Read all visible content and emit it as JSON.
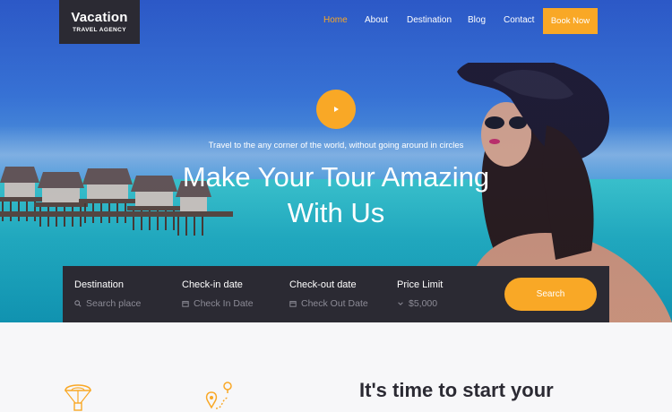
{
  "logo": {
    "title": "Vacation",
    "subtitle": "TRAVEL AGENCY"
  },
  "nav": {
    "items": [
      {
        "label": "Home",
        "active": true
      },
      {
        "label": "About",
        "active": false
      },
      {
        "label": "Destination",
        "active": false
      },
      {
        "label": "Blog",
        "active": false
      },
      {
        "label": "Contact",
        "active": false
      }
    ],
    "book_label": "Book Now"
  },
  "hero": {
    "tagline": "Travel to the any corner of the world, without going around in circles",
    "headline_line1": "Make Your Tour Amazing",
    "headline_line2": "With Us"
  },
  "search": {
    "destination": {
      "label": "Destination",
      "placeholder": "Search place",
      "icon": "search-icon"
    },
    "checkin": {
      "label": "Check-in date",
      "placeholder": "Check In Date",
      "icon": "calendar-icon"
    },
    "checkout": {
      "label": "Check-out date",
      "placeholder": "Check Out Date",
      "icon": "calendar-icon"
    },
    "price": {
      "label": "Price Limit",
      "value": "$5,000",
      "icon": "chevron-down-icon"
    },
    "button_label": "Search"
  },
  "section": {
    "title_line1": "It's time to start your"
  },
  "colors": {
    "accent": "#f9a826",
    "dark": "#2b2a33",
    "muted": "#8c8b96"
  }
}
